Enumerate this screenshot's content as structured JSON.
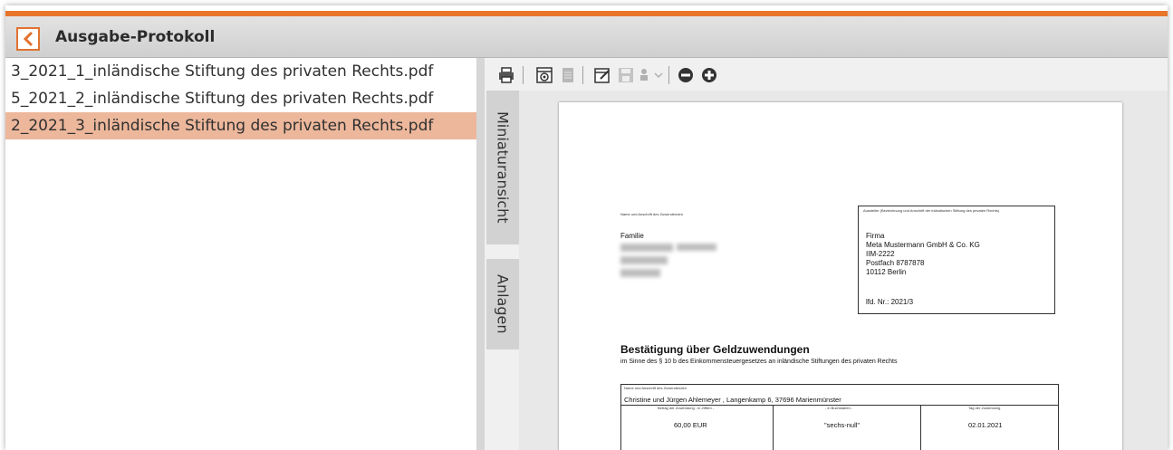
{
  "header": {
    "title": "Ausgabe-Protokoll"
  },
  "files": [
    {
      "label": "3_2021_1_inländische Stiftung des privaten Rechts.pdf",
      "selected": false
    },
    {
      "label": "5_2021_2_inländische Stiftung des privaten Rechts.pdf",
      "selected": false
    },
    {
      "label": "2_2021_3_inländische Stiftung des privaten Rechts.pdf",
      "selected": true
    }
  ],
  "sidetabs": {
    "thumbnails": "Miniaturansicht",
    "attachments": "Anlagen"
  },
  "colors": {
    "accent": "#e8752b",
    "selected_row": "#ecb79b"
  },
  "document": {
    "donor_label": "Name und Anschrift des Zuwendenden",
    "donor_salutation": "Familie",
    "recipient_label": "Aussteller (Bezeichnung und Anschrift der inländischen Stiftung des privaten Rechts)",
    "recipient_lines": [
      "Firma",
      "Meta Mustermann GmbH & Co. KG",
      "IIM-2222",
      "Postfach 8787878",
      "10112 Berlin"
    ],
    "lfd_nr": "lfd. Nr.: 2021/3",
    "heading": "Bestätigung über Geldzuwendungen",
    "subheading": "im Sinne des § 10 b des Einkommensteuergesetzes an inländische Stiftungen des privaten Rechts",
    "table": {
      "donor_label": "Name und Anschrift des Zuwendenden",
      "donor_value": "Christine und Jürgen Ahlemeyer , Langenkamp 6, 37696 Marienmünster",
      "col_amount_label": "Betrag der Zuwendung - in Ziffern -",
      "col_words_label": "- in Buchstaben -",
      "col_date_label": "Tag der Zuwendung",
      "amount": "60,00 EUR",
      "words": "\"sechs-null\"",
      "date": "02.01.2021"
    }
  }
}
